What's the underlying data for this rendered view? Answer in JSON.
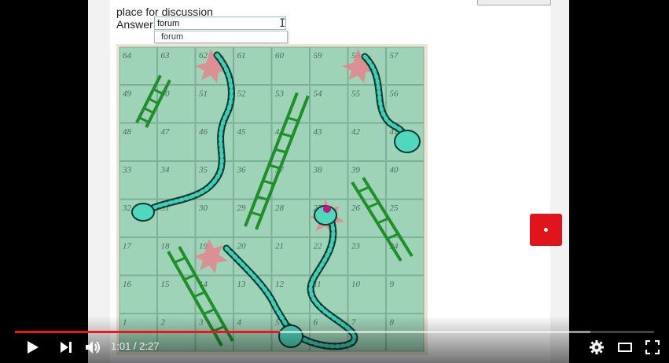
{
  "question": {
    "prompt": "place for discussion",
    "answer_label": "Answer:",
    "answer_value": "forum",
    "suggestion": "forum"
  },
  "board": {
    "numbers": [
      [
        "64",
        "63",
        "62",
        "61",
        "60",
        "59",
        "58",
        "57"
      ],
      [
        "49",
        "50",
        "51",
        "52",
        "53",
        "54",
        "55",
        "56"
      ],
      [
        "48",
        "47",
        "46",
        "45",
        "44",
        "43",
        "42",
        "41"
      ],
      [
        "33",
        "34",
        "35",
        "36",
        "37",
        "38",
        "39",
        "40"
      ],
      [
        "32",
        "31",
        "30",
        "29",
        "28",
        "27",
        "26",
        "25"
      ],
      [
        "17",
        "18",
        "19",
        "20",
        "21",
        "22",
        "23",
        "24"
      ],
      [
        "16",
        "15",
        "14",
        "13",
        "12",
        "11",
        "10",
        "9"
      ],
      [
        "1",
        "2",
        "3",
        "4",
        "5",
        "6",
        "7",
        "8"
      ]
    ],
    "tile_color": "#9fd3b8",
    "grid_color": "#7faf98"
  },
  "player": {
    "current_time": "1:01",
    "separator": " / ",
    "duration": "2:27",
    "progress_fraction": 0.415,
    "buffer_fraction": 0.9,
    "accent_color": "#e21b1b",
    "icons": {
      "play": "play-icon",
      "next": "next-icon",
      "volume": "volume-icon",
      "settings": "gear-icon",
      "theater": "theater-mode-icon",
      "fullscreen": "fullscreen-icon"
    }
  }
}
